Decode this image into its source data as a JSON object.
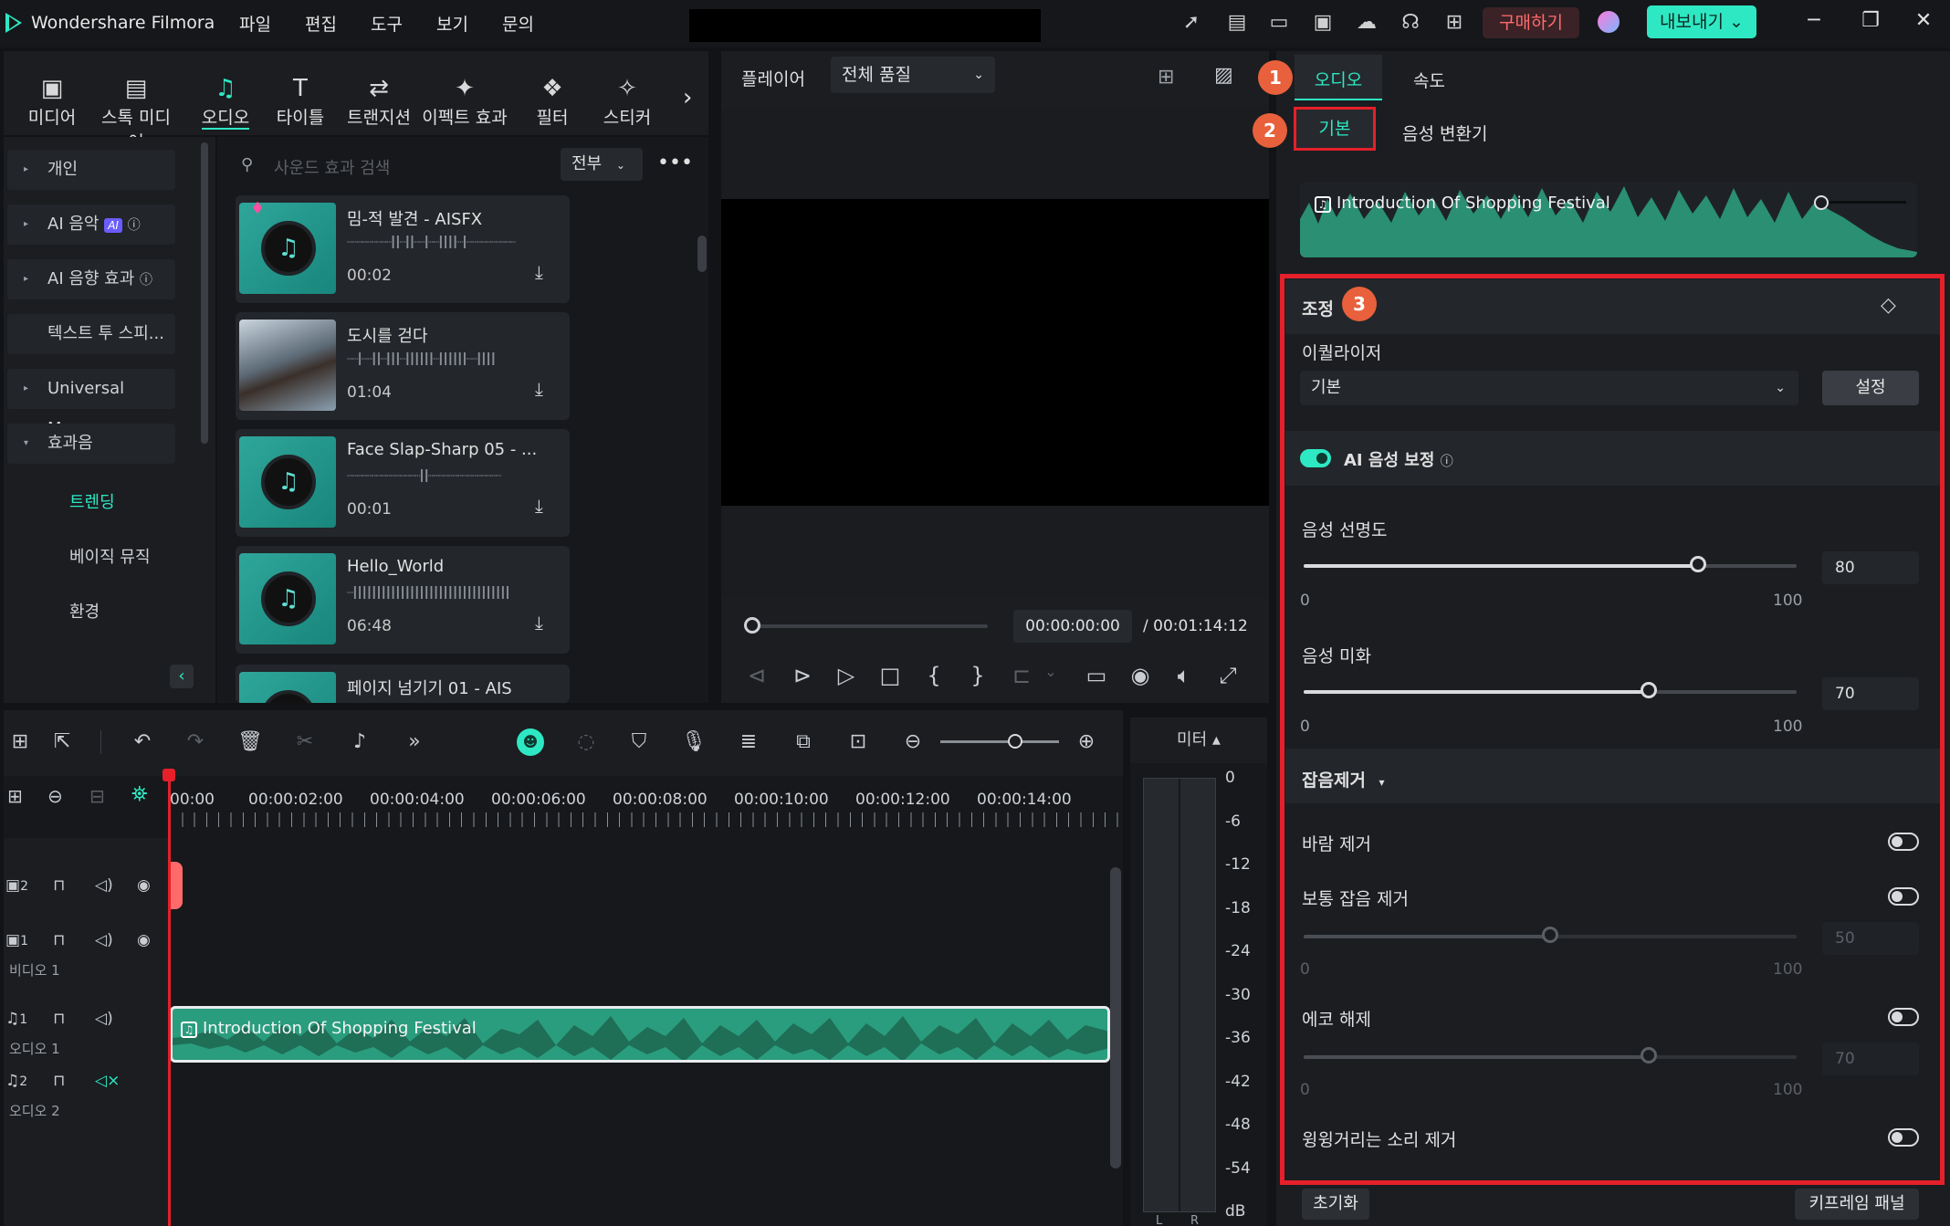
{
  "app": {
    "name": "Wondershare Filmora"
  },
  "menu": [
    "파일",
    "편집",
    "도구",
    "보기",
    "문의"
  ],
  "titlebar": {
    "buy": "구매하기",
    "export": "내보내기",
    "export_arrow": "⌄"
  },
  "toolbar": [
    {
      "label": "미디어",
      "icon": "media-icon"
    },
    {
      "label": "스톡 미디어",
      "icon": "stock-media-icon"
    },
    {
      "label": "오디오",
      "icon": "audio-icon"
    },
    {
      "label": "타이틀",
      "icon": "title-icon"
    },
    {
      "label": "트랜지션",
      "icon": "transition-icon"
    },
    {
      "label": "이펙트 효과",
      "icon": "effects-icon"
    },
    {
      "label": "필터",
      "icon": "filter-icon"
    },
    {
      "label": "스티커",
      "icon": "sticker-icon"
    }
  ],
  "sidebar": {
    "items": [
      "개인",
      "AI 음악",
      "AI 음향 효과",
      "텍스트 투 스피...",
      "Universal Mus...",
      "효과음"
    ],
    "ai_badge": "AI",
    "subitems": [
      "트렌딩",
      "베이직 뮤직",
      "환경"
    ]
  },
  "search": {
    "placeholder": "사운드 효과 검색",
    "filter": "전부"
  },
  "list": [
    {
      "title": "밈-적 발견 - AISFX",
      "duration": "00:02"
    },
    {
      "title": "도시를 걷다",
      "duration": "01:04"
    },
    {
      "title": "Face Slap-Sharp 05 - ...",
      "duration": "00:01"
    },
    {
      "title": "Hello_World",
      "duration": "06:48"
    },
    {
      "title": "페이지 넘기기 01 - AIS",
      "duration": ""
    }
  ],
  "player": {
    "label": "플레이어",
    "quality": "전체 품질",
    "timecode": "00:00:00:00",
    "total": "/  00:01:14:12"
  },
  "right": {
    "tab_audio": "오디오",
    "tab_speed": "속도",
    "tab_basic": "기본",
    "tab_voice": "음성 변환기",
    "clip_name": "Introduction Of Shopping Festival",
    "adjust_title": "조정",
    "equalizer_label": "이퀄라이저",
    "equalizer_value": "기본",
    "equalizer_settings": "설정",
    "ai_voice": "AI 음성 보정",
    "clarity": {
      "label": "음성 선명도",
      "value": "80",
      "min": "0",
      "max": "100"
    },
    "beautify": {
      "label": "음성 미화",
      "value": "70",
      "min": "0",
      "max": "100"
    },
    "denoise_title": "잡음제거",
    "wind": {
      "label": "바람 제거",
      "on": false
    },
    "normal_noise": {
      "label": "보통 잡음 제거",
      "on": false,
      "value": "50",
      "min": "0",
      "max": "100"
    },
    "echo": {
      "label": "에코 해제",
      "on": false,
      "value": "70",
      "min": "0",
      "max": "100"
    },
    "hum": {
      "label": "윙윙거리는 소리 제거",
      "on": false
    },
    "reset": "초기화",
    "keyframe": "키프레임 패널",
    "badges": [
      "1",
      "2",
      "3"
    ]
  },
  "timeline": {
    "ruler": [
      "00:00",
      "00:00:02:00",
      "00:00:04:00",
      "00:00:06:00",
      "00:00:08:00",
      "00:00:10:00",
      "00:00:12:00",
      "00:00:14:00"
    ],
    "tracks": [
      {
        "num": "2",
        "label": ""
      },
      {
        "num": "1",
        "label": "비디오 1"
      },
      {
        "num": "1",
        "label": "오디오 1"
      },
      {
        "num": "2",
        "label": "오디오 2"
      }
    ],
    "clip": "Introduction Of Shopping Festival",
    "meter_label": "미터 ▴",
    "meter_scale": [
      "0",
      "-6",
      "-12",
      "-18",
      "-24",
      "-30",
      "-36",
      "-42",
      "-48",
      "-54",
      "dB"
    ],
    "meter_lr": [
      "L",
      "R"
    ]
  }
}
